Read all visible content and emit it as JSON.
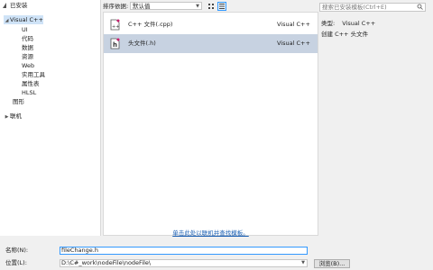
{
  "tree": {
    "header": "已安装",
    "items": [
      {
        "label": "Visual C++",
        "arrow": "◢",
        "selected": true
      },
      {
        "label": "UI"
      },
      {
        "label": "代码"
      },
      {
        "label": "数据"
      },
      {
        "label": "资源"
      },
      {
        "label": "Web"
      },
      {
        "label": "实用工具"
      },
      {
        "label": "属性表"
      },
      {
        "label": "HLSL"
      },
      {
        "label": "图形"
      },
      {
        "label": "联机",
        "arrow": "▶"
      }
    ]
  },
  "sortbar": {
    "label": "排序依据:",
    "value": "默认值"
  },
  "templates": [
    {
      "name": "C++ 文件(.cpp)",
      "lang": "Visual C++",
      "icon_letter": "++",
      "selected": false
    },
    {
      "name": "头文件(.h)",
      "lang": "Visual C++",
      "icon_letter": "h",
      "selected": true
    }
  ],
  "online_link": "单击此处以联机并查找模板。",
  "search": {
    "placeholder": "搜索已安装模板(Ctrl+E)"
  },
  "info": {
    "type_label": "类型:",
    "type_value": "Visual C++",
    "description": "创建 C++ 头文件"
  },
  "fields": {
    "name_label": "名称(N):",
    "name_value": "fileChange.h",
    "location_label": "位置(L):",
    "location_value": "D:\\C#_work\\nodeFile\\nodeFile\\",
    "browse_label": "浏览(B)..."
  },
  "colors": {
    "accent": "#3399ff",
    "selected_row": "#c7d2e1",
    "icon_badge": "#c81e6e"
  }
}
